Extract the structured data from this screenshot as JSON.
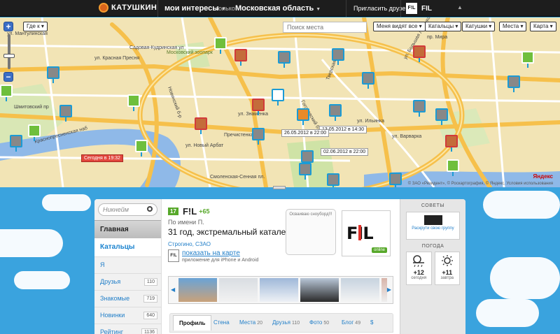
{
  "header": {
    "brand": "КАТУШКИН",
    "interests": "мои интересы",
    "only": "только",
    "region": "Московская область",
    "invite": "Пригласить друзей",
    "user_badge": "F!L",
    "user": "FIL"
  },
  "map": {
    "filter_where": "Где к",
    "search_placeholder": "Поиск места",
    "filter_visible": "Меня видят все",
    "dropdowns": [
      "Катальцы",
      "Катушки",
      "Места",
      "Карта"
    ],
    "timestamps": [
      "Сегодня в 19:32",
      "26.05.2012 в 22:00",
      "02.06.2012 в 22:00",
      "13.05.2012 в 14:30"
    ],
    "streets": [
      "ул. Красная Пресня",
      "Новинский б-р",
      "Смоленская-Сенная пл.",
      "Гоголевский б-р",
      "ул. Знаменка",
      "Тверская ул",
      "Садовая-Кудринская ул",
      "ул. Большая Лубянка",
      "ул. Варварка",
      "Пречистенка ул",
      "ул. Ильинка",
      "Краснопресненская наб",
      "Шмитовский пр",
      "ул. Мантулинская",
      "Арбатская пл",
      "ул. Новый Арбат",
      "пр. Мира"
    ],
    "zoo": "Московский зоопарк",
    "copyright": "© ЗАО «Резидент», © Роскартография, © Яндекс, Условия использования",
    "yandex": "Яндекс"
  },
  "sidebar": {
    "search_placeholder": "Никнейм",
    "header": "Главная",
    "active": "Катальцы",
    "items": [
      {
        "label": "Я",
        "count": ""
      },
      {
        "label": "Друзья",
        "count": "110"
      },
      {
        "label": "Знакомые",
        "count": "719"
      },
      {
        "label": "Новинки",
        "count": "640"
      },
      {
        "label": "Рейтинг",
        "count": "1136"
      }
    ]
  },
  "profile": {
    "level": "17",
    "name": "F!L",
    "plus": "+65",
    "subname": "По имени П.",
    "headline": "31 год, экстремальный каталец",
    "place": "Строгино, СЗАО",
    "bubble": "Осваиваю сноуборд!!!",
    "avatar_text": "FIL",
    "online": "online",
    "show_map": "показать на карте",
    "app_note": "приложение для iPhone и Android"
  },
  "tabs": [
    {
      "label": "Профиль",
      "count": ""
    },
    {
      "label": "Стена",
      "count": ""
    },
    {
      "label": "Места",
      "count": "20"
    },
    {
      "label": "Друзья",
      "count": "110"
    },
    {
      "label": "Фото",
      "count": "50"
    },
    {
      "label": "Блог",
      "count": "49"
    },
    {
      "label": "$",
      "count": ""
    }
  ],
  "right": {
    "advice_header": "СОВЕТЫ",
    "advice_link": "Раскрути свою группу",
    "weather_header": "ПОГОДА",
    "weather": [
      {
        "temp": "+12",
        "day": "сегодня"
      },
      {
        "temp": "+11",
        "day": "завтра"
      }
    ]
  },
  "colors": {
    "accent_blue": "#2480c9",
    "green": "#57a82a",
    "topbar": "#1d1d1d",
    "sky": "#3aa3de"
  }
}
